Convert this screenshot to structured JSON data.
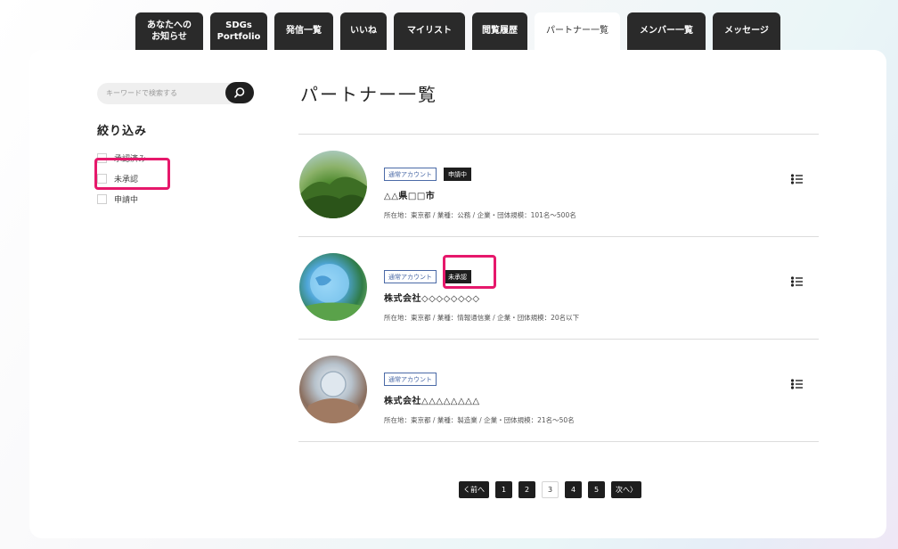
{
  "tabs": [
    {
      "label": "あなたへの\nお知らせ",
      "width": 76,
      "active": false
    },
    {
      "label": "SDGs\nPortfolio",
      "width": 64,
      "active": false
    },
    {
      "label": "発信一覧",
      "width": 66,
      "active": false
    },
    {
      "label": "いいね",
      "width": 52,
      "active": false
    },
    {
      "label": "マイリスト",
      "width": 80,
      "active": false
    },
    {
      "label": "閲覧履歴",
      "width": 62,
      "active": false
    },
    {
      "label": "パートナー一覧",
      "width": 96,
      "active": true
    },
    {
      "label": "メンバー一覧",
      "width": 88,
      "active": false
    },
    {
      "label": "メッセージ",
      "width": 76,
      "active": false
    }
  ],
  "search": {
    "placeholder": "キーワードで検索する"
  },
  "filter": {
    "title": "絞り込み",
    "items": [
      "承認済み",
      "未承認",
      "申請中"
    ]
  },
  "page": {
    "title": "パートナー一覧"
  },
  "partners": [
    {
      "account_tag": "通常アカウント",
      "status_tag": "申請中",
      "name": "△△県□□市",
      "meta": "所在地：東京都 / 業種：公務 / 企業・団体規模：101名～500名"
    },
    {
      "account_tag": "通常アカウント",
      "status_tag": "未承認",
      "name": "株式会社◇◇◇◇◇◇◇◇",
      "meta": "所在地：東京都 / 業種：情報通信業 / 企業・団体規模：20名以下"
    },
    {
      "account_tag": "通常アカウント",
      "status_tag": "",
      "name": "株式会社△△△△△△△△",
      "meta": "所在地：東京都 / 業種：製造業 / 企業・団体規模：21名～50名"
    }
  ],
  "pagination": {
    "prev": "く前へ",
    "pages": [
      "1",
      "2",
      "3",
      "4",
      "5"
    ],
    "current": "3",
    "next": "次へ〉"
  }
}
